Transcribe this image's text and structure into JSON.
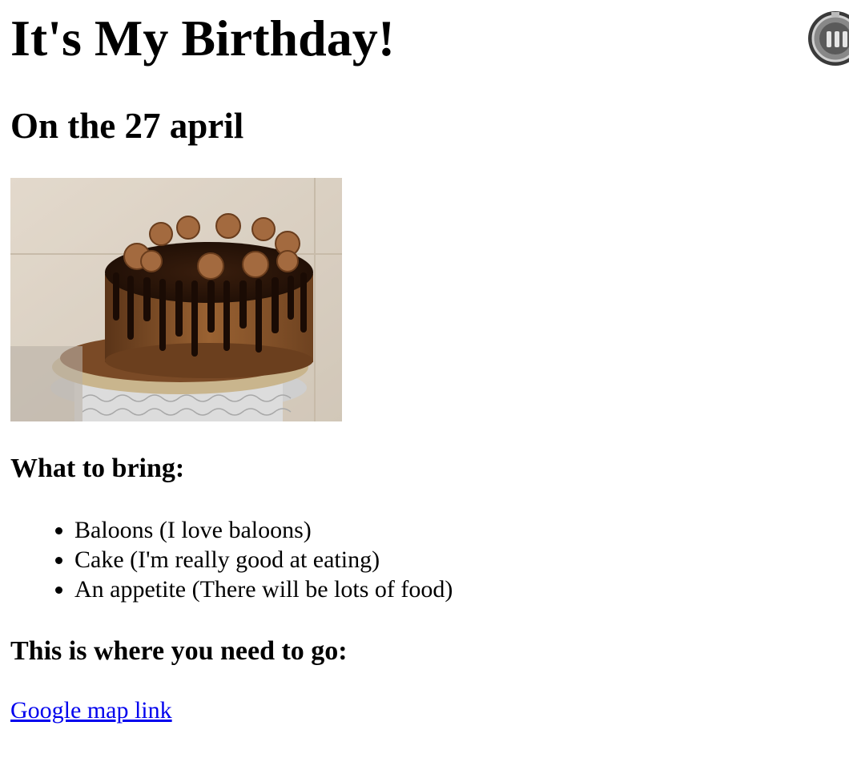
{
  "page": {
    "title": "It's My Birthday!",
    "date_heading": "On the 27 april",
    "image_alt": "Chocolate birthday cake",
    "bring_heading": "What to bring:",
    "bring_items": [
      "Baloons (I love baloons)",
      "Cake (I'm really good at eating)",
      "An appetite (There will be lots of food)"
    ],
    "where_heading": "This is where you need to go:",
    "map_link_label": "Google map link"
  },
  "colors": {
    "link": "#0000ee",
    "text": "#000000",
    "background": "#ffffff"
  },
  "icons": {
    "corner_badge": "extension-badge-icon"
  }
}
